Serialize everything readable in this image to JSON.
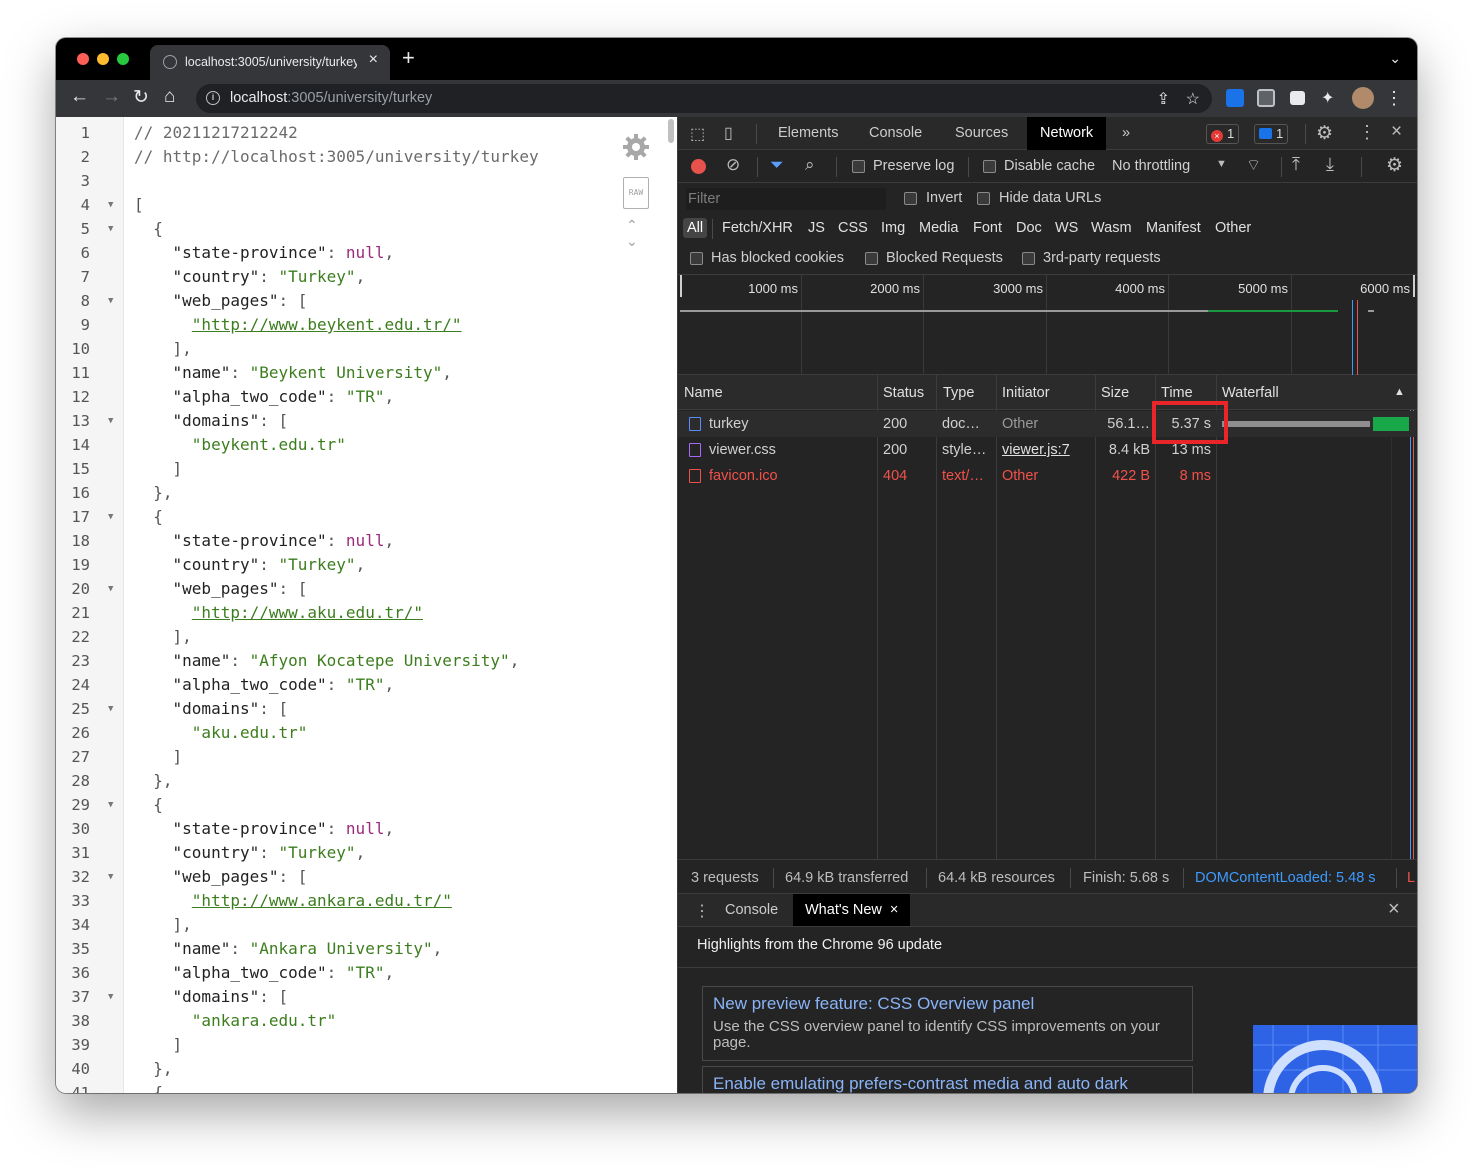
{
  "browser": {
    "tab_title": "localhost:3005/university/turkey",
    "url_host": "localhost",
    "url_rest": ":3005/university/turkey"
  },
  "viewer": {
    "lines": [
      {
        "n": "1",
        "fold": "",
        "segs": [
          {
            "t": "// 20211217212242",
            "c": "c-com"
          }
        ]
      },
      {
        "n": "2",
        "fold": "",
        "segs": [
          {
            "t": "// http://localhost:3005/university/turkey",
            "c": "c-com"
          }
        ]
      },
      {
        "n": "3",
        "fold": "",
        "segs": []
      },
      {
        "n": "4",
        "fold": "▼",
        "segs": [
          {
            "t": "[",
            "c": "c-pun"
          }
        ]
      },
      {
        "n": "5",
        "fold": "▼",
        "segs": [
          {
            "t": "  {",
            "c": "c-pun"
          }
        ]
      },
      {
        "n": "6",
        "fold": "",
        "segs": [
          {
            "t": "    \"state-province\"",
            "c": "c-key"
          },
          {
            "t": ": ",
            "c": "c-pun"
          },
          {
            "t": "null",
            "c": "c-null"
          },
          {
            "t": ",",
            "c": "c-pun"
          }
        ]
      },
      {
        "n": "7",
        "fold": "",
        "segs": [
          {
            "t": "    \"country\"",
            "c": "c-key"
          },
          {
            "t": ": ",
            "c": "c-pun"
          },
          {
            "t": "\"Turkey\"",
            "c": "c-str"
          },
          {
            "t": ",",
            "c": "c-pun"
          }
        ]
      },
      {
        "n": "8",
        "fold": "▼",
        "segs": [
          {
            "t": "    \"web_pages\"",
            "c": "c-key"
          },
          {
            "t": ": [",
            "c": "c-pun"
          }
        ]
      },
      {
        "n": "9",
        "fold": "",
        "segs": [
          {
            "t": "      ",
            "c": "c-pun"
          },
          {
            "t": "\"http://www.beykent.edu.tr/\"",
            "c": "c-url"
          }
        ]
      },
      {
        "n": "10",
        "fold": "",
        "segs": [
          {
            "t": "    ],",
            "c": "c-pun"
          }
        ]
      },
      {
        "n": "11",
        "fold": "",
        "segs": [
          {
            "t": "    \"name\"",
            "c": "c-key"
          },
          {
            "t": ": ",
            "c": "c-pun"
          },
          {
            "t": "\"Beykent University\"",
            "c": "c-str"
          },
          {
            "t": ",",
            "c": "c-pun"
          }
        ]
      },
      {
        "n": "12",
        "fold": "",
        "segs": [
          {
            "t": "    \"alpha_two_code\"",
            "c": "c-key"
          },
          {
            "t": ": ",
            "c": "c-pun"
          },
          {
            "t": "\"TR\"",
            "c": "c-str"
          },
          {
            "t": ",",
            "c": "c-pun"
          }
        ]
      },
      {
        "n": "13",
        "fold": "▼",
        "segs": [
          {
            "t": "    \"domains\"",
            "c": "c-key"
          },
          {
            "t": ": [",
            "c": "c-pun"
          }
        ]
      },
      {
        "n": "14",
        "fold": "",
        "segs": [
          {
            "t": "      ",
            "c": "c-pun"
          },
          {
            "t": "\"beykent.edu.tr\"",
            "c": "c-str"
          }
        ]
      },
      {
        "n": "15",
        "fold": "",
        "segs": [
          {
            "t": "    ]",
            "c": "c-pun"
          }
        ]
      },
      {
        "n": "16",
        "fold": "",
        "segs": [
          {
            "t": "  },",
            "c": "c-pun"
          }
        ]
      },
      {
        "n": "17",
        "fold": "▼",
        "segs": [
          {
            "t": "  {",
            "c": "c-pun"
          }
        ]
      },
      {
        "n": "18",
        "fold": "",
        "segs": [
          {
            "t": "    \"state-province\"",
            "c": "c-key"
          },
          {
            "t": ": ",
            "c": "c-pun"
          },
          {
            "t": "null",
            "c": "c-null"
          },
          {
            "t": ",",
            "c": "c-pun"
          }
        ]
      },
      {
        "n": "19",
        "fold": "",
        "segs": [
          {
            "t": "    \"country\"",
            "c": "c-key"
          },
          {
            "t": ": ",
            "c": "c-pun"
          },
          {
            "t": "\"Turkey\"",
            "c": "c-str"
          },
          {
            "t": ",",
            "c": "c-pun"
          }
        ]
      },
      {
        "n": "20",
        "fold": "▼",
        "segs": [
          {
            "t": "    \"web_pages\"",
            "c": "c-key"
          },
          {
            "t": ": [",
            "c": "c-pun"
          }
        ]
      },
      {
        "n": "21",
        "fold": "",
        "segs": [
          {
            "t": "      ",
            "c": "c-pun"
          },
          {
            "t": "\"http://www.aku.edu.tr/\"",
            "c": "c-url"
          }
        ]
      },
      {
        "n": "22",
        "fold": "",
        "segs": [
          {
            "t": "    ],",
            "c": "c-pun"
          }
        ]
      },
      {
        "n": "23",
        "fold": "",
        "segs": [
          {
            "t": "    \"name\"",
            "c": "c-key"
          },
          {
            "t": ": ",
            "c": "c-pun"
          },
          {
            "t": "\"Afyon Kocatepe University\"",
            "c": "c-str"
          },
          {
            "t": ",",
            "c": "c-pun"
          }
        ]
      },
      {
        "n": "24",
        "fold": "",
        "segs": [
          {
            "t": "    \"alpha_two_code\"",
            "c": "c-key"
          },
          {
            "t": ": ",
            "c": "c-pun"
          },
          {
            "t": "\"TR\"",
            "c": "c-str"
          },
          {
            "t": ",",
            "c": "c-pun"
          }
        ]
      },
      {
        "n": "25",
        "fold": "▼",
        "segs": [
          {
            "t": "    \"domains\"",
            "c": "c-key"
          },
          {
            "t": ": [",
            "c": "c-pun"
          }
        ]
      },
      {
        "n": "26",
        "fold": "",
        "segs": [
          {
            "t": "      ",
            "c": "c-pun"
          },
          {
            "t": "\"aku.edu.tr\"",
            "c": "c-str"
          }
        ]
      },
      {
        "n": "27",
        "fold": "",
        "segs": [
          {
            "t": "    ]",
            "c": "c-pun"
          }
        ]
      },
      {
        "n": "28",
        "fold": "",
        "segs": [
          {
            "t": "  },",
            "c": "c-pun"
          }
        ]
      },
      {
        "n": "29",
        "fold": "▼",
        "segs": [
          {
            "t": "  {",
            "c": "c-pun"
          }
        ]
      },
      {
        "n": "30",
        "fold": "",
        "segs": [
          {
            "t": "    \"state-province\"",
            "c": "c-key"
          },
          {
            "t": ": ",
            "c": "c-pun"
          },
          {
            "t": "null",
            "c": "c-null"
          },
          {
            "t": ",",
            "c": "c-pun"
          }
        ]
      },
      {
        "n": "31",
        "fold": "",
        "segs": [
          {
            "t": "    \"country\"",
            "c": "c-key"
          },
          {
            "t": ": ",
            "c": "c-pun"
          },
          {
            "t": "\"Turkey\"",
            "c": "c-str"
          },
          {
            "t": ",",
            "c": "c-pun"
          }
        ]
      },
      {
        "n": "32",
        "fold": "▼",
        "segs": [
          {
            "t": "    \"web_pages\"",
            "c": "c-key"
          },
          {
            "t": ": [",
            "c": "c-pun"
          }
        ]
      },
      {
        "n": "33",
        "fold": "",
        "segs": [
          {
            "t": "      ",
            "c": "c-pun"
          },
          {
            "t": "\"http://www.ankara.edu.tr/\"",
            "c": "c-url"
          }
        ]
      },
      {
        "n": "34",
        "fold": "",
        "segs": [
          {
            "t": "    ],",
            "c": "c-pun"
          }
        ]
      },
      {
        "n": "35",
        "fold": "",
        "segs": [
          {
            "t": "    \"name\"",
            "c": "c-key"
          },
          {
            "t": ": ",
            "c": "c-pun"
          },
          {
            "t": "\"Ankara University\"",
            "c": "c-str"
          },
          {
            "t": ",",
            "c": "c-pun"
          }
        ]
      },
      {
        "n": "36",
        "fold": "",
        "segs": [
          {
            "t": "    \"alpha_two_code\"",
            "c": "c-key"
          },
          {
            "t": ": ",
            "c": "c-pun"
          },
          {
            "t": "\"TR\"",
            "c": "c-str"
          },
          {
            "t": ",",
            "c": "c-pun"
          }
        ]
      },
      {
        "n": "37",
        "fold": "▼",
        "segs": [
          {
            "t": "    \"domains\"",
            "c": "c-key"
          },
          {
            "t": ": [",
            "c": "c-pun"
          }
        ]
      },
      {
        "n": "38",
        "fold": "",
        "segs": [
          {
            "t": "      ",
            "c": "c-pun"
          },
          {
            "t": "\"ankara.edu.tr\"",
            "c": "c-str"
          }
        ]
      },
      {
        "n": "39",
        "fold": "",
        "segs": [
          {
            "t": "    ]",
            "c": "c-pun"
          }
        ]
      },
      {
        "n": "40",
        "fold": "",
        "segs": [
          {
            "t": "  },",
            "c": "c-pun"
          }
        ]
      },
      {
        "n": "41",
        "fold": "",
        "segs": [
          {
            "t": "  {",
            "c": "c-pun"
          }
        ]
      }
    ],
    "raw_label": "RAW"
  },
  "devtools": {
    "tabs": [
      "Elements",
      "Console",
      "Sources",
      "Network"
    ],
    "active_tab": "Network",
    "more_tabs": "»",
    "error_count": "1",
    "message_count": "1",
    "toolbar": {
      "preserve_log": "Preserve log",
      "disable_cache": "Disable cache",
      "throttling": "No throttling"
    },
    "filter": {
      "placeholder": "Filter",
      "invert": "Invert",
      "hide_data_urls": "Hide data URLs"
    },
    "type_filters": [
      "All",
      "Fetch/XHR",
      "JS",
      "CSS",
      "Img",
      "Media",
      "Font",
      "Doc",
      "WS",
      "Wasm",
      "Manifest",
      "Other"
    ],
    "selected_type": "All",
    "blocked": {
      "has_blocked_cookies": "Has blocked cookies",
      "blocked_requests": "Blocked Requests",
      "third_party": "3rd-party requests"
    },
    "overview_ticks": [
      "1000 ms",
      "2000 ms",
      "3000 ms",
      "4000 ms",
      "5000 ms",
      "6000 ms"
    ],
    "columns": {
      "name": "Name",
      "status": "Status",
      "type": "Type",
      "initiator": "Initiator",
      "size": "Size",
      "time": "Time",
      "waterfall": "Waterfall",
      "sort_icon": "▲"
    },
    "requests": [
      {
        "name": "turkey",
        "status": "200",
        "type": "doc…",
        "initiator": "Other",
        "size": "56.1…",
        "time": "5.37 s",
        "icon": "doc",
        "error": false
      },
      {
        "name": "viewer.css",
        "status": "200",
        "type": "style…",
        "initiator": "viewer.js:7",
        "size": "8.4 kB",
        "time": "13 ms",
        "icon": "css",
        "error": false
      },
      {
        "name": "favicon.ico",
        "status": "404",
        "type": "text/…",
        "initiator": "Other",
        "size": "422 B",
        "time": "8 ms",
        "icon": "err",
        "error": true
      }
    ],
    "summary": {
      "requests": "3 requests",
      "transferred": "64.9 kB transferred",
      "resources": "64.4 kB resources",
      "finish": "Finish: 5.68 s",
      "dcl": "DOMContentLoaded: 5.48 s",
      "load_stub": "L"
    },
    "drawer": {
      "tabs": [
        "Console",
        "What's New"
      ],
      "active": "What's New",
      "headline": "Highlights from the Chrome 96 update",
      "cards": [
        {
          "title": "New preview feature: CSS Overview panel",
          "desc": "Use the CSS overview panel to identify CSS improvements on your page."
        },
        {
          "title": "Enable emulating prefers-contrast media and auto dark",
          "desc": ""
        }
      ]
    }
  },
  "colors": {
    "accent_blue": "#8ab4f8",
    "error_red": "#f2514b",
    "highlight_red": "#e8262a",
    "dcl_blue": "#3d9bff"
  }
}
